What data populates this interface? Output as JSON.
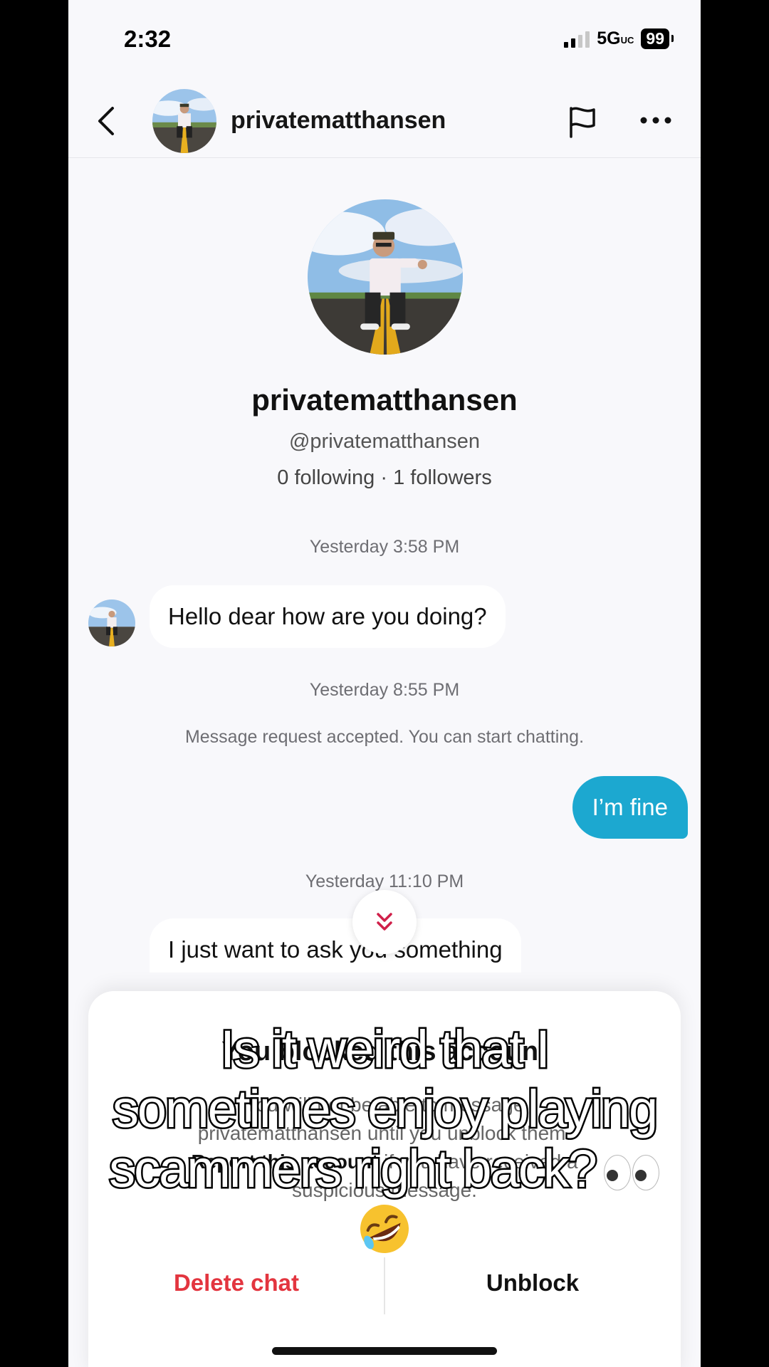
{
  "status_bar": {
    "time": "2:32",
    "network": "5G",
    "network_sub": "UC",
    "battery": "99"
  },
  "header": {
    "username": "privatematthansen"
  },
  "profile": {
    "name": "privatematthansen",
    "handle": "@privatematthansen",
    "stats": "0 following · 1 followers"
  },
  "chat": {
    "timestamp_1": "Yesterday 3:58 PM",
    "message_1": "Hello dear how are you doing?",
    "timestamp_2": "Yesterday 8:55 PM",
    "system_message": "Message request accepted. You can start chatting.",
    "reply_1": "I’m fine",
    "timestamp_3": "Yesterday 11:10 PM",
    "message_2": "I just want to ask you something"
  },
  "sheet": {
    "title": "You blocked this account",
    "body_line1": "You will not be able to message",
    "body_line2": "privatematthansen until you unblock them.",
    "body_report": "Report this account",
    "body_line3": " if you have received a",
    "body_line4": "suspicious message.",
    "delete_label": "Delete chat",
    "unblock_label": "Unblock"
  },
  "caption": {
    "line1": "Is it weird that I",
    "line2": "sometimes enjoy playing",
    "line3": "scammers right back?"
  },
  "colors": {
    "accent_blue": "#1ca8d0",
    "delete_red": "#e3353f",
    "scroll_arrow": "#d0204a"
  },
  "icons": [
    "back-arrow-icon",
    "flag-icon",
    "more-dots-icon",
    "double-chevron-down-icon",
    "eyes-emoji",
    "rolling-laughing-emoji"
  ]
}
